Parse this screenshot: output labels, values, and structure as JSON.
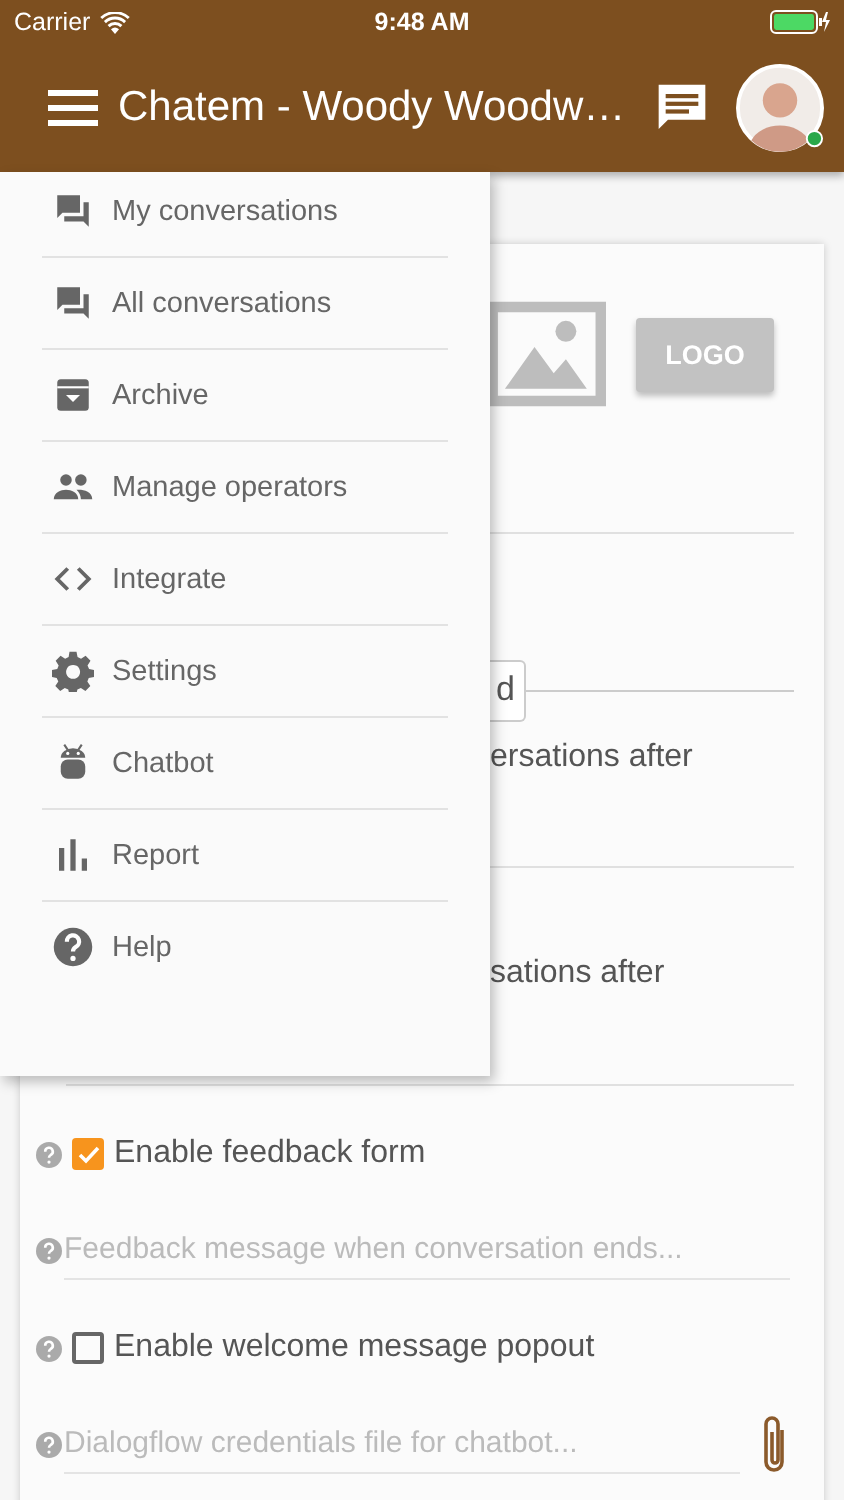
{
  "status_bar": {
    "carrier": "Carrier",
    "time": "9:48 AM"
  },
  "app_bar": {
    "title": "Chatem - Woody Woodw…"
  },
  "drawer": {
    "items": [
      {
        "kind": "forum",
        "label": "My conversations"
      },
      {
        "kind": "forum",
        "label": "All conversations"
      },
      {
        "kind": "archive",
        "label": "Archive"
      },
      {
        "kind": "people",
        "label": "Manage operators"
      },
      {
        "kind": "code",
        "label": "Integrate"
      },
      {
        "kind": "gear",
        "label": "Settings"
      },
      {
        "kind": "robot",
        "label": "Chatbot"
      },
      {
        "kind": "chart",
        "label": "Report"
      },
      {
        "kind": "help",
        "label": "Help"
      }
    ]
  },
  "settings": {
    "logo_button": "LOGO",
    "tab_label": "d",
    "text_1": "ersations after",
    "text_2": "sations after",
    "options": [
      {
        "kind": "checkbox",
        "label": "Enable feedback form",
        "checked": true
      },
      {
        "kind": "input",
        "placeholder": "Feedback message when conversation ends..."
      },
      {
        "kind": "checkbox",
        "label": "Enable welcome message popout",
        "checked": false
      },
      {
        "kind": "file",
        "placeholder": "Dialogflow credentials file for chatbot..."
      }
    ]
  }
}
